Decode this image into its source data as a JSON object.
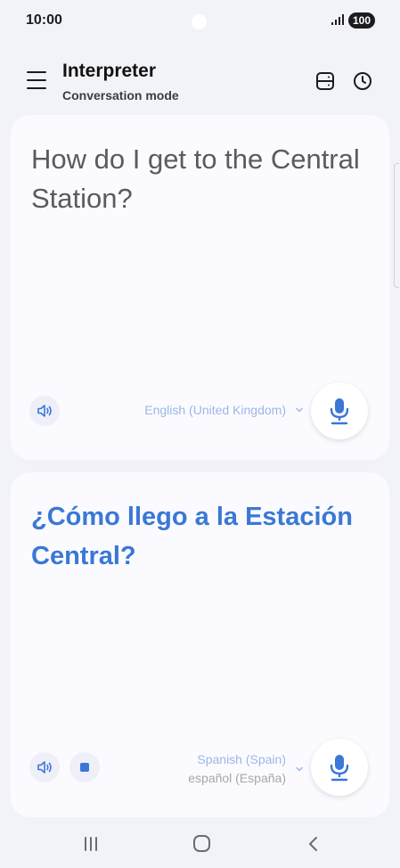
{
  "status_bar": {
    "time": "10:00",
    "battery": "100"
  },
  "header": {
    "title": "Interpreter",
    "subtitle": "Conversation mode"
  },
  "source": {
    "text": "How do I get to the Central Station?",
    "language": "English (United Kingdom)"
  },
  "target": {
    "text": "¿Cómo llego a la Estación Central?",
    "language": "Spanish (Spain)",
    "language_native": "español (España)"
  },
  "colors": {
    "accent": "#3a78d6",
    "card": "#fbfbff",
    "background": "#f2f3f8"
  },
  "icons": [
    "menu-icon",
    "layout-icon",
    "history-icon",
    "speaker-icon",
    "stop-icon",
    "chevron-down-icon",
    "microphone-icon",
    "recent-apps-icon",
    "home-icon",
    "back-icon"
  ]
}
